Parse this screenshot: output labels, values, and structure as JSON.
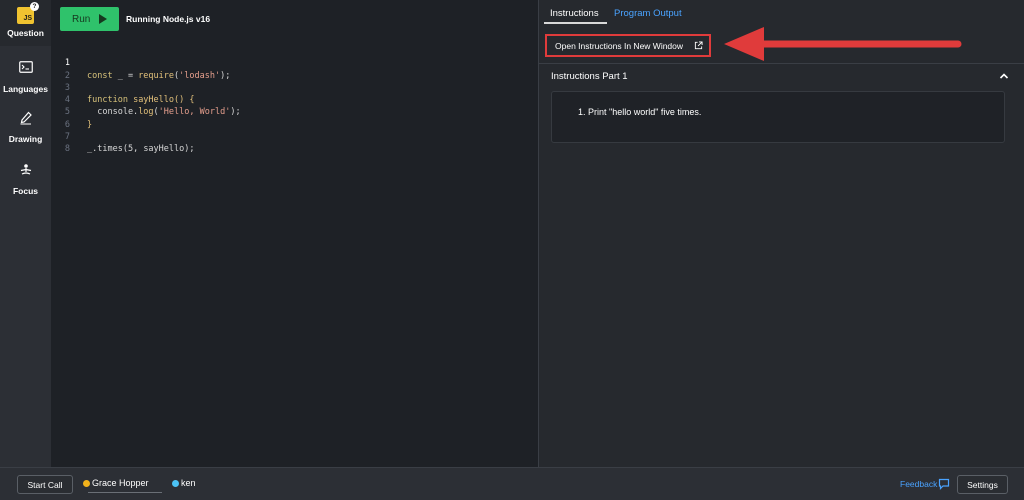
{
  "sidebar": {
    "items": [
      {
        "label": "Question",
        "badge": "JS",
        "badge_mark": "?"
      },
      {
        "label": "Languages"
      },
      {
        "label": "Drawing"
      },
      {
        "label": "Focus"
      }
    ]
  },
  "editor": {
    "run_label": "Run",
    "runtime": "Running Node.js v16",
    "lines": [
      {
        "num": "1"
      },
      {
        "num": "2"
      },
      {
        "num": "3"
      },
      {
        "num": "4"
      },
      {
        "num": "5"
      },
      {
        "num": "6"
      },
      {
        "num": "7"
      },
      {
        "num": "8"
      }
    ],
    "code": {
      "l1_kw": "const",
      "l1_mid": " _ = ",
      "l1_fn": "require",
      "l1_open": "(",
      "l1_str": "'lodash'",
      "l1_close": ");",
      "l3_kw": "function",
      "l3_name": " sayHello",
      "l3_rest": "() {",
      "l4_obj": "  console.",
      "l4_fn": "log",
      "l4_open": "(",
      "l4_str": "'Hello, World'",
      "l4_close": ");",
      "l5": "}",
      "l7_a": "_.",
      "l7_fn": "times",
      "l7_rest": "(5, sayHello);"
    }
  },
  "right_panel": {
    "tabs": [
      {
        "label": "Instructions",
        "active": true
      },
      {
        "label": "Program Output",
        "active": false
      }
    ],
    "open_button": "Open Instructions In New Window",
    "section_title": "Instructions Part 1",
    "instructions": [
      "1. Print \"hello world\" five times."
    ]
  },
  "bottom_bar": {
    "start_call": "Start Call",
    "users": [
      {
        "name": "Grace Hopper",
        "color": "#f2b21b"
      },
      {
        "name": "ken",
        "color": "#4cc3f5"
      }
    ],
    "feedback": "Feedback",
    "settings": "Settings"
  },
  "colors": {
    "run_green": "#2fc26b",
    "highlight_red": "#e03b3b",
    "link_blue": "#4aa3ff",
    "js_yellow": "#f0c330"
  }
}
